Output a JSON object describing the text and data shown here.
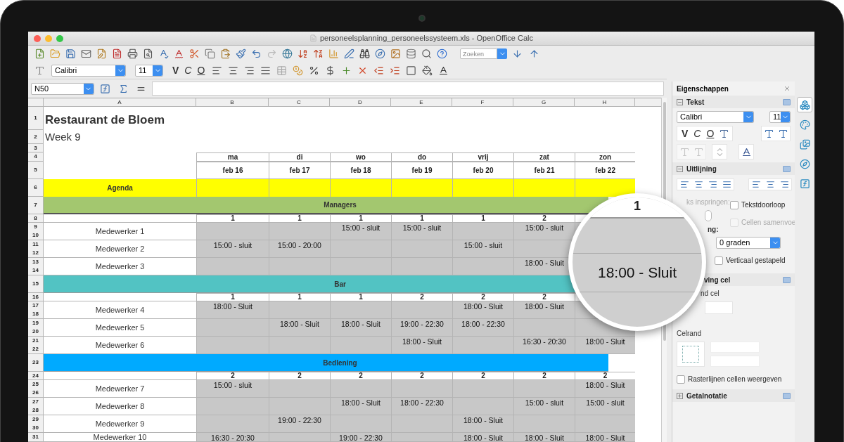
{
  "window": {
    "title": "personeelsplanning_personeelssysteem.xls - OpenOffice Calc"
  },
  "toolbar": {
    "search": {
      "placeholder": "Zoeken"
    },
    "font": "Calibri",
    "size": "11",
    "format_buttons": [
      "V",
      "C",
      "O"
    ]
  },
  "formula_bar": {
    "name_box": "N50"
  },
  "sheet": {
    "columns": [
      "A",
      "B",
      "C",
      "D",
      "E",
      "F",
      "G",
      "H"
    ],
    "rows": [
      {
        "kind": "title",
        "numbers": [
          "1"
        ],
        "text": "Restaurant de Bloem"
      },
      {
        "kind": "subtitle",
        "numbers": [
          "2"
        ],
        "text": "Week 9"
      },
      {
        "kind": "spacer",
        "numbers": [
          "3"
        ]
      },
      {
        "kind": "days",
        "numbers": [
          "4"
        ],
        "cells": [
          "ma",
          "di",
          "wo",
          "do",
          "vrij",
          "zat",
          "zon"
        ]
      },
      {
        "kind": "dates",
        "numbers": [
          "5"
        ],
        "cells": [
          "feb 16",
          "feb 17",
          "feb 18",
          "feb 19",
          "feb 20",
          "feb 21",
          "feb 22"
        ]
      },
      {
        "kind": "agenda",
        "numbers": [
          "6"
        ],
        "name": "Agenda",
        "color": "#ffff00"
      },
      {
        "kind": "group",
        "numbers": [
          "7"
        ],
        "label": "Managers",
        "color": "#a3c76f"
      },
      {
        "kind": "counts",
        "numbers": [
          "8"
        ],
        "cells": [
          "1",
          "1",
          "1",
          "1",
          "1",
          "2",
          null
        ]
      },
      {
        "kind": "employee",
        "numbers": [
          "9",
          "10"
        ],
        "name": "Medewerker 1",
        "cells": [
          null,
          null,
          "15:00 - sluit",
          "15:00 - sluit",
          null,
          "15:00 - sluit",
          null
        ]
      },
      {
        "kind": "employee",
        "numbers": [
          "11",
          "12"
        ],
        "name": "Medewerker 2",
        "cells": [
          "15:00 - sluit",
          "15:00 - 20:00",
          null,
          null,
          "15:00 - sluit",
          null
        ]
      },
      {
        "kind": "employee",
        "numbers": [
          "13",
          "14"
        ],
        "name": "Medewerker 3",
        "cells": [
          null,
          null,
          null,
          null,
          null,
          "18:00 - Sluit"
        ]
      },
      {
        "kind": "group",
        "numbers": [
          "15"
        ],
        "label": "Bar",
        "color": "#52c3c3"
      },
      {
        "kind": "counts",
        "numbers": [
          "16"
        ],
        "cells": [
          "1",
          "1",
          "1",
          "2",
          "2",
          "2",
          null
        ]
      },
      {
        "kind": "employee",
        "numbers": [
          "17",
          "18"
        ],
        "name": "Medewerker 4",
        "cells": [
          "18:00 - Sluit",
          null,
          null,
          null,
          "18:00 - Sluit",
          "18:00 - Sluit",
          null
        ]
      },
      {
        "kind": "employee",
        "numbers": [
          "19",
          "20"
        ],
        "name": "Medewerker 5",
        "cells": [
          null,
          "18:00 - Sluit",
          "18:00 - Sluit",
          "19:00 - 22:30",
          "18:00 - 22:30",
          null,
          null
        ]
      },
      {
        "kind": "employee",
        "numbers": [
          "21",
          "22"
        ],
        "name": "Medewerker 6",
        "cells": [
          null,
          null,
          null,
          "18:00 - Sluit",
          null,
          "16:30 - 20:30",
          "18:00 - Sluit"
        ]
      },
      {
        "kind": "group",
        "numbers": [
          "23"
        ],
        "label": "Bedlening",
        "color": "#00aaff"
      },
      {
        "kind": "counts",
        "numbers": [
          "24"
        ],
        "cells": [
          "2",
          "2",
          "2",
          "2",
          "2",
          "2",
          "2"
        ]
      },
      {
        "kind": "employee",
        "numbers": [
          "25",
          "26"
        ],
        "name": "Medewerker 7",
        "cells": [
          "15:00 - sluit",
          null,
          null,
          null,
          null,
          null,
          "18:00 - Sluit"
        ]
      },
      {
        "kind": "employee",
        "numbers": [
          "27",
          "28"
        ],
        "name": "Medewerker 8",
        "cells": [
          null,
          null,
          "18:00 - Sluit",
          "18:00 - 22:30",
          null,
          "15:00 - sluit",
          "15:00 - sluit"
        ]
      },
      {
        "kind": "employee",
        "numbers": [
          "29",
          "30"
        ],
        "name": "Medewerker 9",
        "cells": [
          null,
          "19:00 - 22:30",
          null,
          null,
          "18:00 - Sluit",
          null,
          null
        ]
      },
      {
        "kind": "employee",
        "numbers": [
          "31"
        ],
        "name": "Medewerker 10",
        "cells": [
          "16:30 - 20:30",
          null,
          "19:00 - 22:30",
          null,
          "18:00 - Sluit",
          "18:00 - Sluit",
          "18:00 - Sluit"
        ]
      }
    ]
  },
  "magnifier": {
    "count": "1",
    "cell": "18:00 - Sluit"
  },
  "sidebar": {
    "title": "Eigenschappen",
    "text_section": {
      "title": "Tekst",
      "expanded": true,
      "font": "Calibri",
      "size": "11",
      "format_buttons": [
        "V",
        "C",
        "O"
      ]
    },
    "alignment_section": {
      "title": "Uitlijning",
      "expanded": true,
      "indent_label": "ks inspringen:",
      "wrap": {
        "label": "Tekstdoorloop",
        "checked": false
      },
      "merge": {
        "label": "Cellen samenvoe",
        "checked": false,
        "disabled": true
      },
      "orientation_label": "ng:",
      "rotation": "0 graden",
      "stacked": {
        "label": "Verticaal gestapeld",
        "checked": false
      }
    },
    "cell_section": {
      "title": "ving cel",
      "background_label": "nd cel",
      "border_label": "Celrand",
      "gridlines": {
        "label": "Rasterlijnen cellen weergeven",
        "checked": false
      }
    },
    "number_section": {
      "title": "Getalnotatie",
      "expanded": false
    },
    "tabs": [
      {
        "selected": true
      },
      {
        "selected": false
      },
      {
        "selected": false
      },
      {
        "selected": false
      },
      {
        "selected": false
      }
    ]
  }
}
